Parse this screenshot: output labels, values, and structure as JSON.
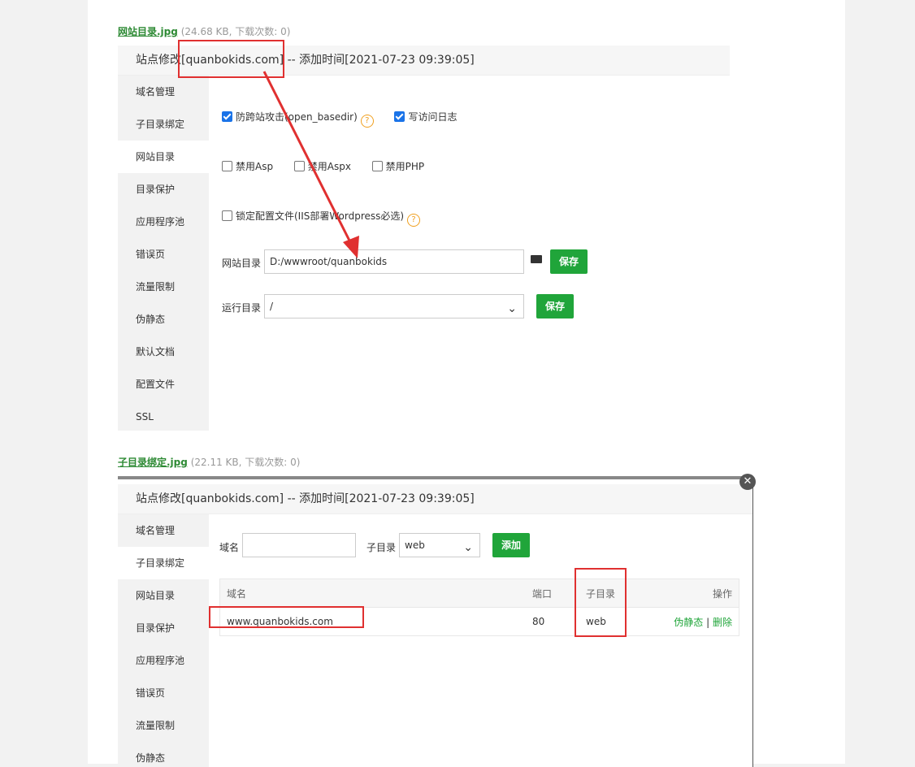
{
  "shot1": {
    "caption_file": "网站目录.jpg",
    "caption_meta": "(24.68 KB, 下载次数: 0)",
    "title": "站点修改[quanbokids.com] -- 添加时间[2021-07-23 09:39:05]",
    "menu": [
      "域名管理",
      "子目录绑定",
      "网站目录",
      "目录保护",
      "应用程序池",
      "错误页",
      "流量限制",
      "伪静态",
      "默认文档",
      "配置文件",
      "SSL"
    ],
    "opt_basedir": "防跨站攻击(open_basedir)",
    "opt_log": "写访问日志",
    "opt_asp": "禁用Asp",
    "opt_aspx": "禁用Aspx",
    "opt_php": "禁用PHP",
    "opt_lock": "锁定配置文件(IIS部署Wordpress必选)",
    "site_dir_label": "网站目录",
    "site_dir_value": "D:/wwwroot/quanbokids",
    "run_dir_label": "运行目录",
    "run_dir_value": "/",
    "save": "保存"
  },
  "shot2": {
    "caption_file": "子目录绑定.jpg",
    "caption_meta": "(22.11 KB, 下载次数: 0)",
    "title": "站点修改[quanbokids.com] -- 添加时间[2021-07-23 09:39:05]",
    "menu": [
      "域名管理",
      "子目录绑定",
      "网站目录",
      "目录保护",
      "应用程序池",
      "错误页",
      "流量限制",
      "伪静态"
    ],
    "domain_label": "域名",
    "subdir_label": "子目录",
    "subdir_value": "web",
    "add": "添加",
    "cols": [
      "域名",
      "端口",
      "子目录",
      "操作"
    ],
    "row": {
      "domain": "www.quanbokids.com",
      "port": "80",
      "subdir": "web",
      "rewrite": "伪静态",
      "sep": "|",
      "del": "删除"
    }
  },
  "colors": {
    "accent": "#20a53a",
    "annotation": "#e03030"
  }
}
